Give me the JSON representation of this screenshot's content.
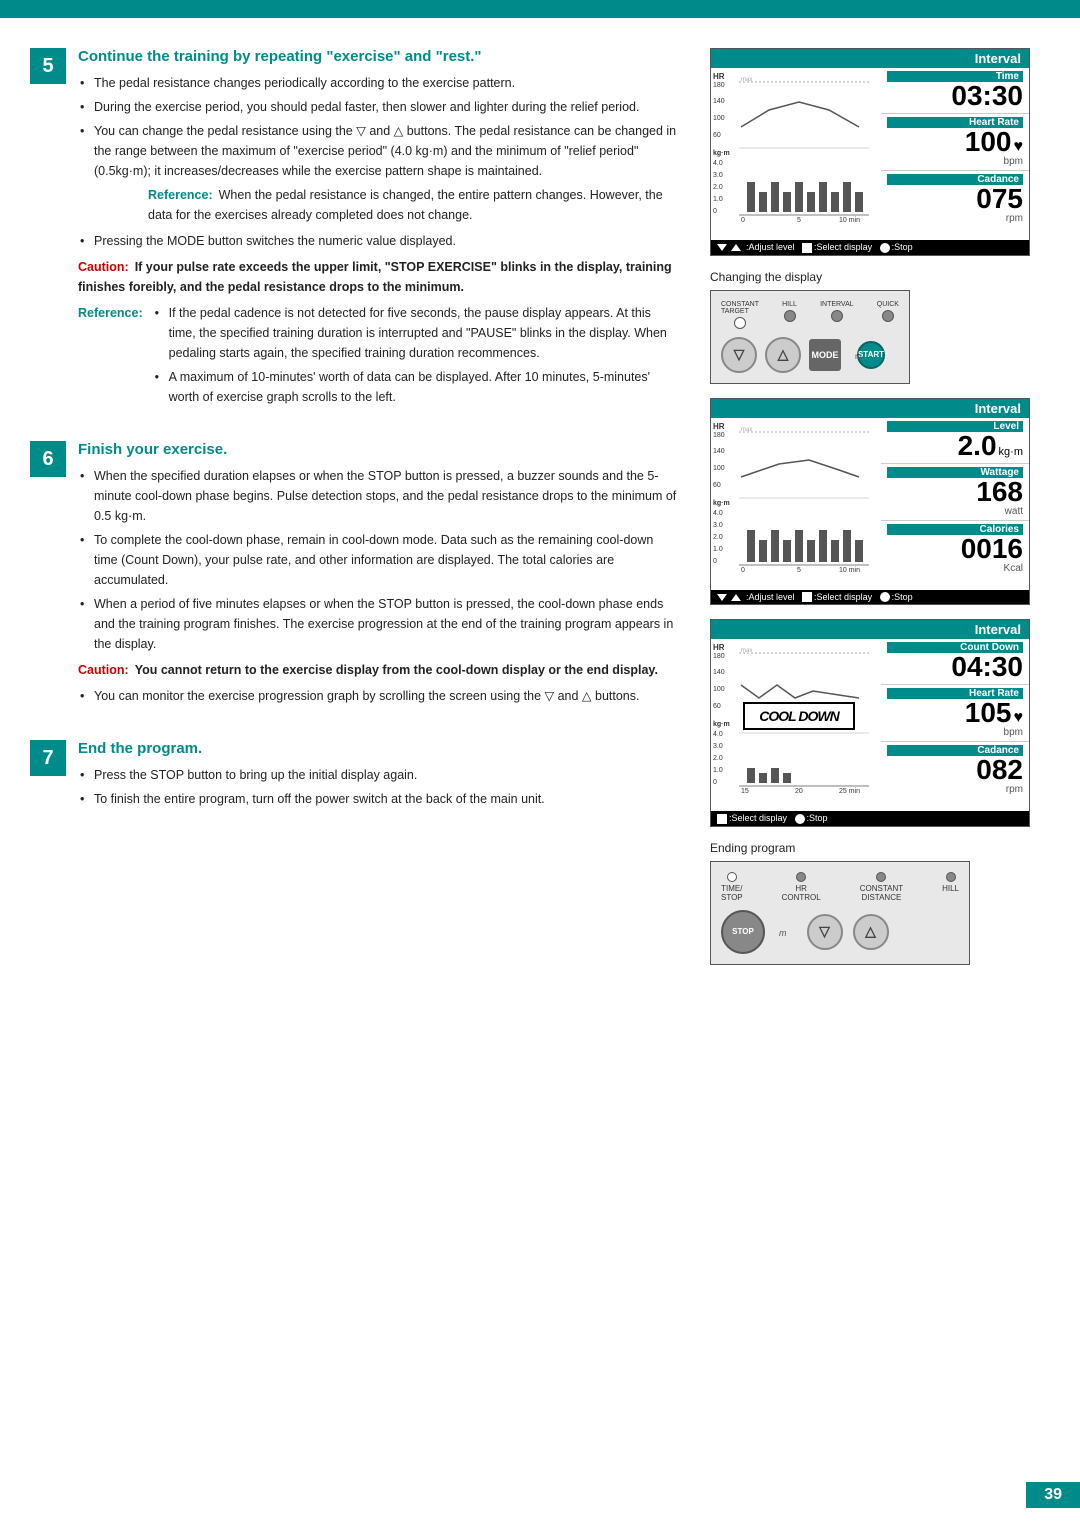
{
  "page": {
    "page_number": "39",
    "top_bar_color": "#008B8B"
  },
  "sections": {
    "section5": {
      "number": "5",
      "title": "Continue the training by repeating \"exercise\" and \"rest.\"",
      "bullets": [
        "The pedal resistance changes periodically according to the exercise pattern.",
        "During the exercise period, you should pedal faster, then slower and lighter during the relief period.",
        "You can change the pedal resistance using the ▽ and △ buttons. The pedal resistance can be changed in the range between the maximum of \"exercise period\" (4.0 kg·m) and the minimum of \"relief period\" (0.5kg·m); it increases/decreases while the exercise pattern shape is maintained."
      ],
      "reference": "When the pedal resistance is changed, the entire pattern changes. However, the data for the exercises already completed does not change.",
      "bullet4": "Pressing the MODE button switches the numeric value displayed.",
      "caution": {
        "label": "Caution:",
        "text": "If your pulse rate exceeds the upper limit, \"STOP EXERCISE\" blinks in the display, training finishes foreibly, and the pedal resistance drops to the minimum."
      },
      "reference2": {
        "label": "Reference:",
        "bullets": [
          "If the pedal cadence is not detected for five seconds, the pause display appears. At this time, the specified training duration is interrupted and \"PAUSE\" blinks in the display. When pedaling starts again, the specified training duration recommences.",
          "A maximum of 10-minutes' worth of data can be displayed. After 10 minutes, 5-minutes' worth of exercise graph scrolls to the left."
        ]
      }
    },
    "section6": {
      "number": "6",
      "title": "Finish your exercise.",
      "bullets": [
        "When the specified duration elapses or when the STOP button is pressed, a buzzer sounds and the 5-minute cool-down phase begins. Pulse detection stops, and the pedal resistance drops to the minimum of 0.5 kg·m.",
        "To complete the cool-down phase, remain in cool-down mode. Data such as the remaining cool-down time (Count Down), your pulse rate, and other information are displayed. The total calories are accumulated.",
        "When a period of five minutes elapses or when the STOP button is pressed, the cool-down phase ends and the training program finishes. The exercise progression at the end of the training program appears in the display."
      ],
      "caution": {
        "label": "Caution:",
        "text": "You cannot return to the exercise display from the cool-down display or the end display."
      },
      "bullet_last": "You can monitor the exercise progression graph by scrolling the screen using the ▽ and △ buttons."
    },
    "section7": {
      "number": "7",
      "title": "End the program.",
      "bullets": [
        "Press the STOP button to bring up the initial display again.",
        "To finish the entire program, turn off the power switch at the back of the main unit."
      ]
    }
  },
  "widgets": {
    "widget1": {
      "header": "Interval",
      "time_label": "Time",
      "time_value": "03:30",
      "heartrate_label": "Heart Rate",
      "heartrate_value": "100",
      "heartrate_unit": "bpm",
      "cadance_label": "Cadance",
      "cadance_value": "075",
      "cadance_unit": "rpm",
      "footer": "▼▲ :Adjust level  ■:Select display  ●:Stop",
      "graph": {
        "hr_label": "HR",
        "hr_values": [
          180,
          140,
          100,
          60
        ],
        "kgm_label": "kg·m",
        "kgm_values": [
          4.0,
          3.0,
          2.0,
          1.0,
          0
        ],
        "x_values": [
          "0",
          "5",
          "10 min"
        ]
      }
    },
    "widget2": {
      "header": "Interval",
      "level_label": "Level",
      "level_value": "2.0",
      "level_unit": "kg·m",
      "wattage_label": "Wattage",
      "wattage_value": "168",
      "wattage_unit": "watt",
      "calories_label": "Calories",
      "calories_value": "0016",
      "calories_unit": "Kcal",
      "footer": "▼▲ :Adjust level  ■:Select display  ●:Stop",
      "graph": {
        "x_values": [
          "0",
          "5",
          "10 min"
        ]
      }
    },
    "widget3": {
      "header": "Interval",
      "countdown_label": "Count Down",
      "countdown_value": "04:30",
      "heartrate_label": "Heart Rate",
      "heartrate_value": "105",
      "heartrate_unit": "bpm",
      "cadance_label": "Cadance",
      "cadance_value": "082",
      "cadance_unit": "rpm",
      "cool_down_text": "COOL DOWN",
      "footer": "■:Select display  ●:Stop",
      "graph": {
        "x_values": [
          "15",
          "20",
          "25 min"
        ]
      }
    }
  },
  "changing_display": {
    "label": "Changing the display",
    "buttons": {
      "row1": [
        "CONSTANT TARGET",
        "HILL",
        "INTERVAL",
        "QUICK"
      ],
      "down_btn": "▽",
      "up_btn": "△",
      "mode_btn": "MODE",
      "start_btn": "START"
    }
  },
  "ending_program": {
    "label": "Ending program",
    "buttons": {
      "row1": [
        "TIME/ STOP",
        "HR CONTROL",
        "CONSTANT DISTANCE",
        "HILL"
      ],
      "stop_btn": "STOP",
      "down_btn": "▽",
      "up_btn": "△"
    }
  }
}
